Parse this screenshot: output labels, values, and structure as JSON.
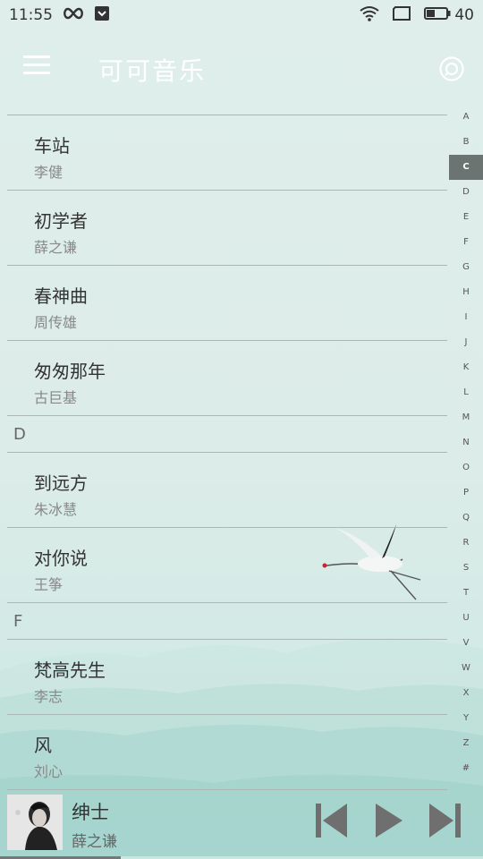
{
  "status_bar": {
    "time": "11:55",
    "battery": "40"
  },
  "app_bar": {
    "title": "可可音乐"
  },
  "list": {
    "items_before": [
      {
        "title": "车站",
        "artist": "李健"
      },
      {
        "title": "初学者",
        "artist": "薛之谦"
      },
      {
        "title": "春神曲",
        "artist": "周传雄"
      },
      {
        "title": "匆匆那年",
        "artist": "古巨基"
      }
    ],
    "section_d": "D",
    "items_d": [
      {
        "title": "到远方",
        "artist": "朱冰慧"
      },
      {
        "title": "对你说",
        "artist": "王筝"
      }
    ],
    "section_f": "F",
    "items_f": [
      {
        "title": "梵高先生",
        "artist": "李志"
      },
      {
        "title": "风",
        "artist": "刘心"
      }
    ]
  },
  "index_bar": {
    "letters": [
      "A",
      "B",
      "C",
      "D",
      "E",
      "F",
      "G",
      "H",
      "I",
      "J",
      "K",
      "L",
      "M",
      "N",
      "O",
      "P",
      "Q",
      "R",
      "S",
      "T",
      "U",
      "V",
      "W",
      "X",
      "Y",
      "Z",
      "#"
    ],
    "active": "C"
  },
  "player": {
    "song": "绅士",
    "singer": "薛之谦",
    "progress": 0.25
  },
  "colors": {
    "accent_active_index": "#6b7471",
    "background": "#dfeeea"
  }
}
